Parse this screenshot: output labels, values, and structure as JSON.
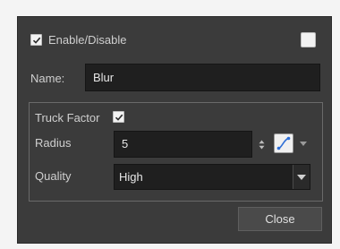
{
  "enable": {
    "label": "Enable/Disable",
    "checked": true
  },
  "color_swatch": {
    "color": "#f2f2f2"
  },
  "name": {
    "label": "Name:",
    "value": "Blur"
  },
  "truck_factor": {
    "label": "Truck Factor",
    "checked": true
  },
  "radius": {
    "label": "Radius",
    "value": "5"
  },
  "quality": {
    "label": "Quality",
    "selected": "High"
  },
  "close_label": "Close",
  "icons": {
    "stepper": "up-down-arrows-icon",
    "function": "function-curve-icon",
    "dropdown": "chevron-down-icon"
  }
}
